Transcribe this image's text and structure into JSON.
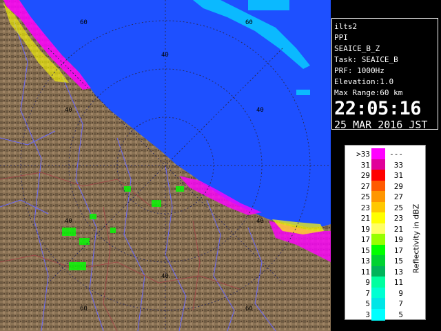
{
  "info": {
    "radar_name": "ilts2",
    "scan_type": "PPI",
    "product": "SEAICE_B_Z",
    "task": "Task: SEAICE_B",
    "prf": "PRF: 1000Hz",
    "elevation": "Elevation:1.0",
    "max_range": "Max Range:60 km",
    "time": "22:05:16",
    "date": "25 MAR 2016 JST"
  },
  "range_labels": [
    "60",
    "40"
  ],
  "legend": {
    "title": "Reflectivity in dBZ",
    "rows": [
      {
        "lo": ">33",
        "hi": "---",
        "color": "#ff00ff"
      },
      {
        "lo": "31",
        "hi": "33",
        "color": "#e0009a"
      },
      {
        "lo": "29",
        "hi": "31",
        "color": "#ff0000"
      },
      {
        "lo": "27",
        "hi": "29",
        "color": "#ff5a00"
      },
      {
        "lo": "25",
        "hi": "27",
        "color": "#ff9600"
      },
      {
        "lo": "23",
        "hi": "25",
        "color": "#ffc800"
      },
      {
        "lo": "21",
        "hi": "23",
        "color": "#ffff00"
      },
      {
        "lo": "19",
        "hi": "21",
        "color": "#ffff64"
      },
      {
        "lo": "17",
        "hi": "19",
        "color": "#96ff00"
      },
      {
        "lo": "15",
        "hi": "17",
        "color": "#00ff00"
      },
      {
        "lo": "13",
        "hi": "15",
        "color": "#00d232"
      },
      {
        "lo": "11",
        "hi": "13",
        "color": "#00b45a"
      },
      {
        "lo": "9",
        "hi": "11",
        "color": "#00ffa0"
      },
      {
        "lo": "7",
        "hi": "9",
        "color": "#00ffd2"
      },
      {
        "lo": "5",
        "hi": "7",
        "color": "#00e6e6"
      },
      {
        "lo": "3",
        "hi": "5",
        "color": "#00ffff"
      }
    ]
  },
  "colors": {
    "sea": "#1e50ff",
    "land": "#8b7355",
    "land_dark": "#5a4632",
    "river": "#6a6aff",
    "boundary": "#a04848",
    "grid": "#2b2b5a"
  }
}
